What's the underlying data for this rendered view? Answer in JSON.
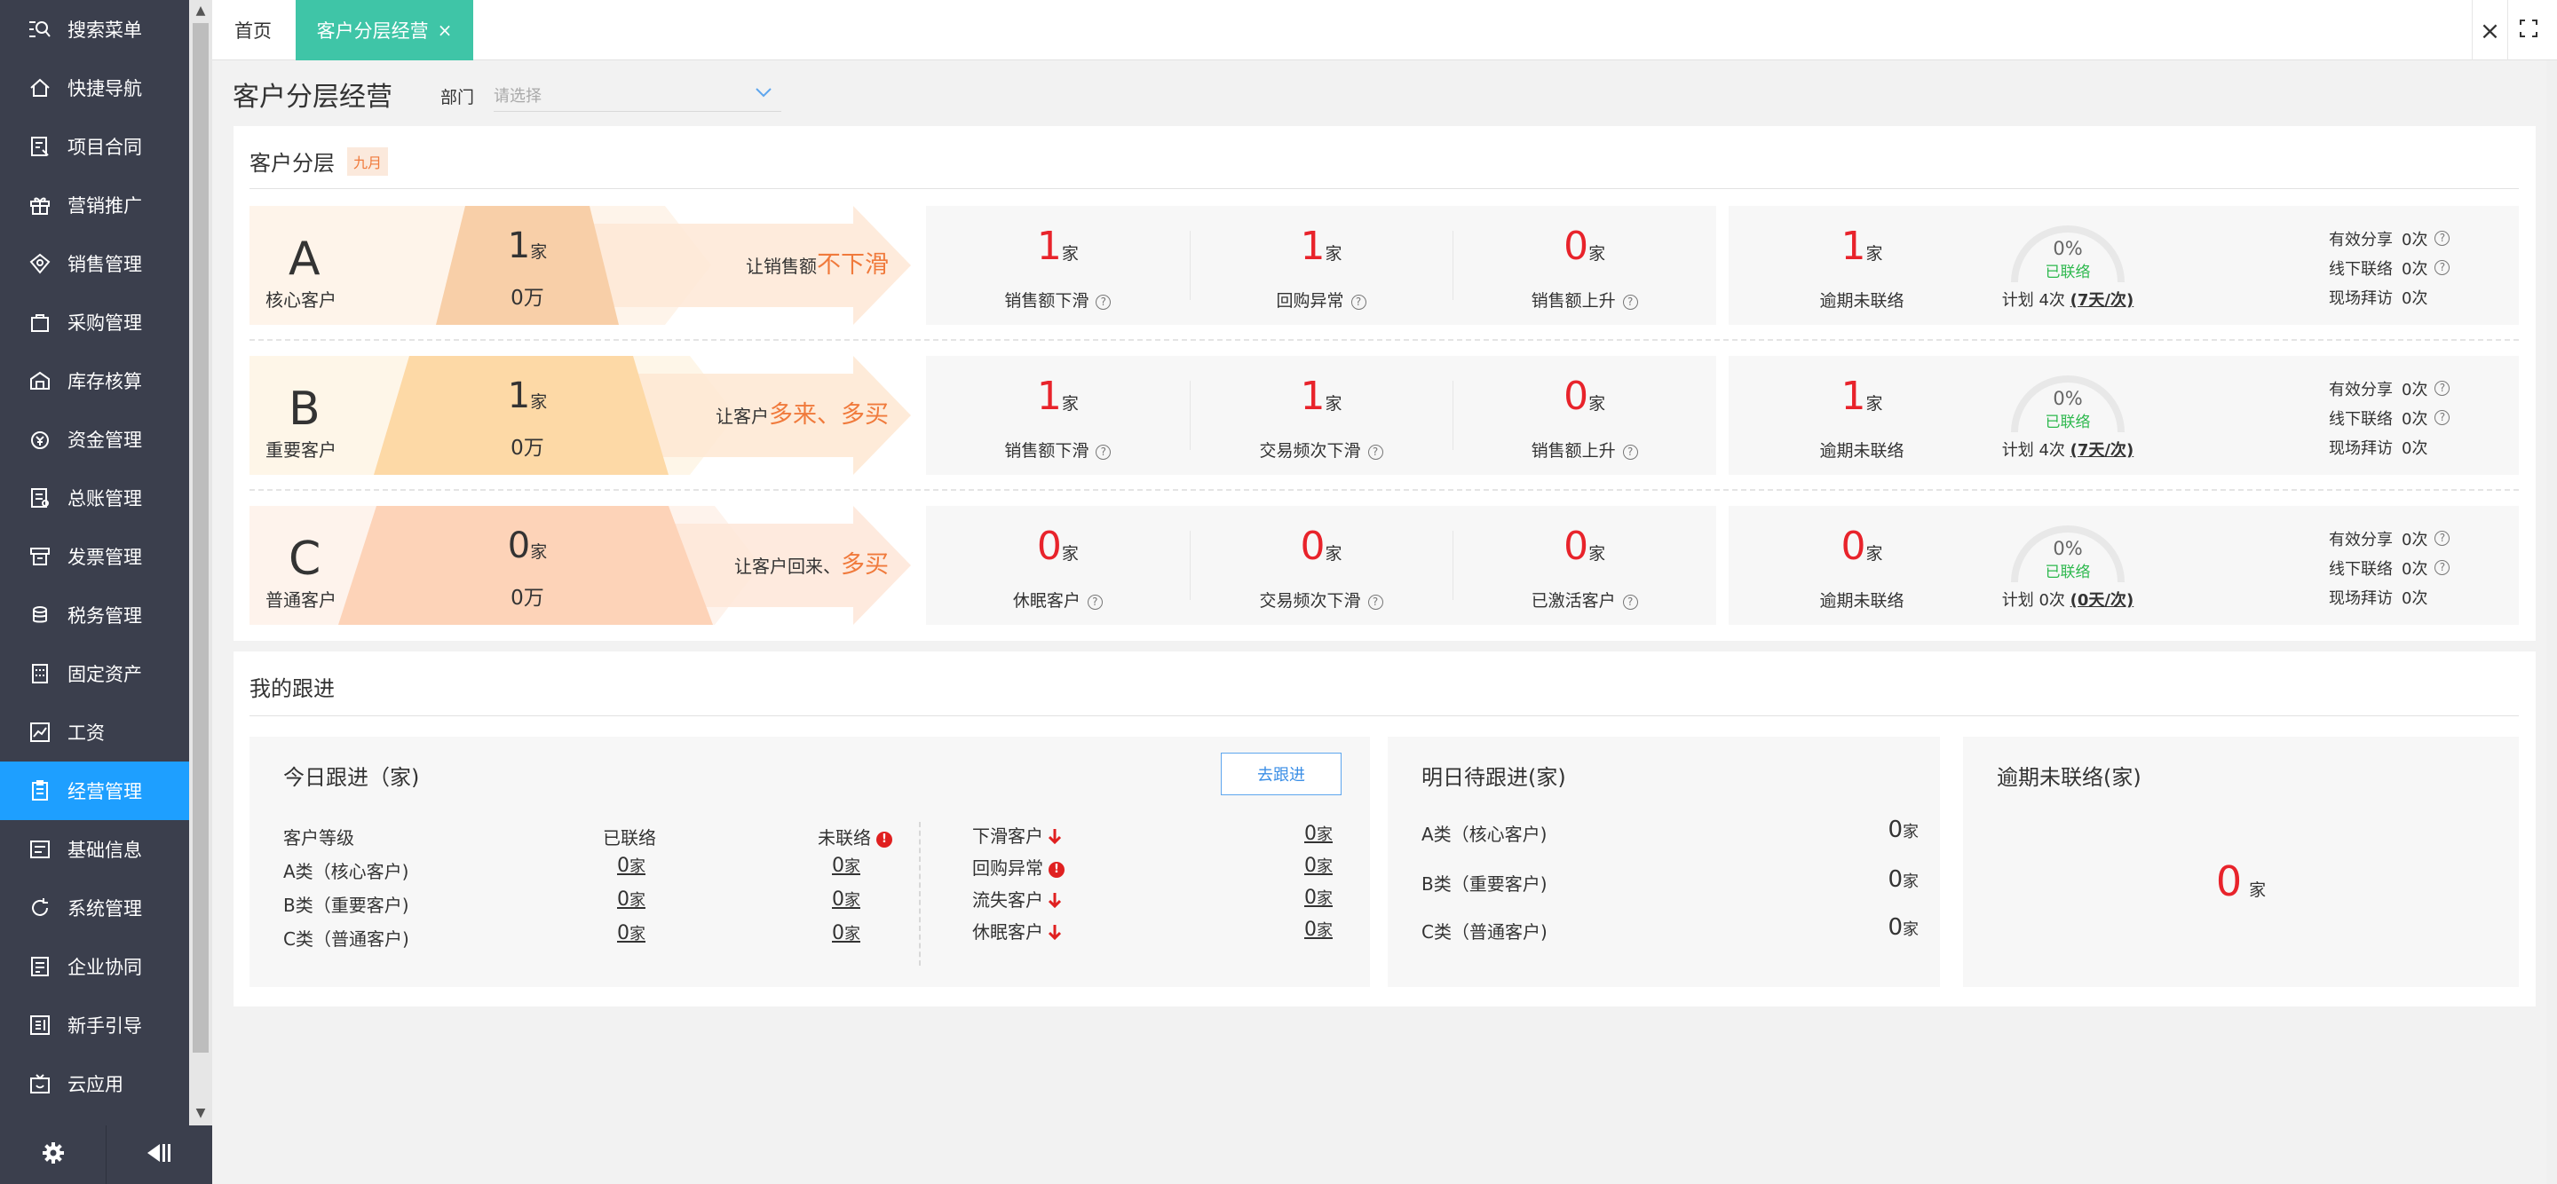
{
  "sidebar": {
    "items": [
      {
        "label": "搜索菜单",
        "icon": "search-menu-icon"
      },
      {
        "label": "快捷导航",
        "icon": "home-icon"
      },
      {
        "label": "项目合同",
        "icon": "contract-icon"
      },
      {
        "label": "营销推广",
        "icon": "gift-icon"
      },
      {
        "label": "销售管理",
        "icon": "sales-icon"
      },
      {
        "label": "采购管理",
        "icon": "bag-icon"
      },
      {
        "label": "库存核算",
        "icon": "warehouse-icon"
      },
      {
        "label": "资金管理",
        "icon": "money-icon"
      },
      {
        "label": "总账管理",
        "icon": "ledger-icon"
      },
      {
        "label": "发票管理",
        "icon": "invoice-icon"
      },
      {
        "label": "税务管理",
        "icon": "tax-icon"
      },
      {
        "label": "固定资产",
        "icon": "building-icon"
      },
      {
        "label": "工资",
        "icon": "chart-icon"
      },
      {
        "label": "经营管理",
        "icon": "clipboard-icon",
        "active": true
      },
      {
        "label": "基础信息",
        "icon": "list-icon"
      },
      {
        "label": "系统管理",
        "icon": "refresh-icon"
      },
      {
        "label": "企业协同",
        "icon": "document-icon"
      },
      {
        "label": "新手引导",
        "icon": "guide-icon"
      },
      {
        "label": "云应用",
        "icon": "tv-icon"
      }
    ],
    "active_color": "#1e9fff"
  },
  "tabs": {
    "home": "首页",
    "active": "客户分层经营",
    "active_color": "#3fc5a7"
  },
  "page": {
    "title": "客户分层经营",
    "dept_label": "部门",
    "dept_placeholder": "请选择"
  },
  "layering": {
    "title": "客户分层",
    "month": "九月",
    "tiers": [
      {
        "letter": "A",
        "name": "核心客户",
        "count": "1",
        "count_unit": "家",
        "amount": "0万",
        "slogan_prefix": "让销售额",
        "slogan_accent": "不下滑",
        "metrics": [
          {
            "value": "1",
            "unit": "家",
            "label": "销售额下滑"
          },
          {
            "value": "1",
            "unit": "家",
            "label": "回购异常"
          },
          {
            "value": "0",
            "unit": "家",
            "label": "销售额上升"
          }
        ],
        "overdue": {
          "value": "1",
          "unit": "家",
          "label": "逾期未联络"
        },
        "gauge": {
          "percent": "0%",
          "status": "已联络"
        },
        "plan": {
          "prefix": "计划",
          "count": "4次",
          "freq": "(7天/次)"
        },
        "stats": [
          {
            "label": "有效分享",
            "value": "0次",
            "help": true
          },
          {
            "label": "线下联络",
            "value": "0次",
            "help": true
          },
          {
            "label": "现场拜访",
            "value": "0次",
            "help": false
          }
        ]
      },
      {
        "letter": "B",
        "name": "重要客户",
        "count": "1",
        "count_unit": "家",
        "amount": "0万",
        "slogan_prefix": "让客户",
        "slogan_accent": "多来、多买",
        "metrics": [
          {
            "value": "1",
            "unit": "家",
            "label": "销售额下滑"
          },
          {
            "value": "1",
            "unit": "家",
            "label": "交易频次下滑"
          },
          {
            "value": "0",
            "unit": "家",
            "label": "销售额上升"
          }
        ],
        "overdue": {
          "value": "1",
          "unit": "家",
          "label": "逾期未联络"
        },
        "gauge": {
          "percent": "0%",
          "status": "已联络"
        },
        "plan": {
          "prefix": "计划",
          "count": "4次",
          "freq": "(7天/次)"
        },
        "stats": [
          {
            "label": "有效分享",
            "value": "0次",
            "help": true
          },
          {
            "label": "线下联络",
            "value": "0次",
            "help": true
          },
          {
            "label": "现场拜访",
            "value": "0次",
            "help": false
          }
        ]
      },
      {
        "letter": "C",
        "name": "普通客户",
        "count": "0",
        "count_unit": "家",
        "amount": "0万",
        "slogan_prefix": "让客户回来、",
        "slogan_accent": "多买",
        "metrics": [
          {
            "value": "0",
            "unit": "家",
            "label": "休眠客户"
          },
          {
            "value": "0",
            "unit": "家",
            "label": "交易频次下滑"
          },
          {
            "value": "0",
            "unit": "家",
            "label": "已激活客户"
          }
        ],
        "overdue": {
          "value": "0",
          "unit": "家",
          "label": "逾期未联络"
        },
        "gauge": {
          "percent": "0%",
          "status": "已联络"
        },
        "plan": {
          "prefix": "计划",
          "count": "0次",
          "freq": "(0天/次)"
        },
        "stats": [
          {
            "label": "有效分享",
            "value": "0次",
            "help": true
          },
          {
            "label": "线下联络",
            "value": "0次",
            "help": true
          },
          {
            "label": "现场拜访",
            "value": "0次",
            "help": false
          }
        ]
      }
    ]
  },
  "follow": {
    "title": "我的跟进",
    "today": {
      "title": "今日跟进（家)",
      "button": "去跟进",
      "headers": {
        "level": "客户等级",
        "contacted": "已联络",
        "not_contacted": "未联络"
      },
      "rows": [
        {
          "label": "A类（核心客户)",
          "contacted": "0",
          "not_contacted": "0"
        },
        {
          "label": "B类（重要客户)",
          "contacted": "0",
          "not_contacted": "0"
        },
        {
          "label": "C类（普通客户)",
          "contacted": "0",
          "not_contacted": "0"
        }
      ],
      "side": [
        {
          "label": "下滑客户",
          "mark": "down",
          "value": "0"
        },
        {
          "label": "回购异常",
          "mark": "alert",
          "value": "0"
        },
        {
          "label": "流失客户",
          "mark": "down",
          "value": "0"
        },
        {
          "label": "休眠客户",
          "mark": "down",
          "value": "0"
        }
      ],
      "unit": "家"
    },
    "tomorrow": {
      "title": "明日待跟进(家)",
      "rows": [
        {
          "label": "A类（核心客户)",
          "value": "0",
          "unit": "家"
        },
        {
          "label": "B类（重要客户)",
          "value": "0",
          "unit": "家"
        },
        {
          "label": "C类（普通客户)",
          "value": "0",
          "unit": "家"
        }
      ]
    },
    "overdue": {
      "title": "逾期未联络(家)",
      "value": "0",
      "unit": "家"
    }
  }
}
